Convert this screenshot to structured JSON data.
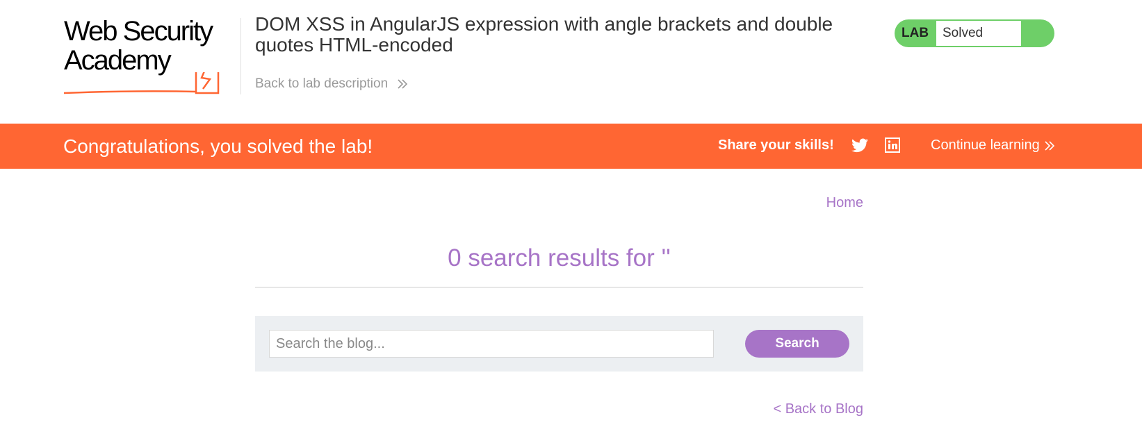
{
  "header": {
    "logo_line1": "Web Security",
    "logo_line2": "Academy",
    "title": "DOM XSS in AngularJS expression with angle brackets and double quotes HTML-encoded",
    "back_link": "Back to lab description",
    "lab_badge": "LAB",
    "lab_status": "Solved"
  },
  "banner": {
    "message": "Congratulations, you solved the lab!",
    "share_label": "Share your skills!",
    "continue_label": "Continue learning",
    "icons": [
      "twitter-icon",
      "linkedin-icon"
    ]
  },
  "nav": {
    "home": "Home"
  },
  "results": {
    "heading": "0 search results for ''"
  },
  "search": {
    "placeholder": "Search the blog...",
    "value": "",
    "button": "Search"
  },
  "footer": {
    "back_to_blog": "< Back to Blog"
  },
  "colors": {
    "accent_orange": "#ff6633",
    "accent_purple": "#a774c7",
    "lab_green": "#6ecf68",
    "panel_bg": "#eceff2"
  }
}
